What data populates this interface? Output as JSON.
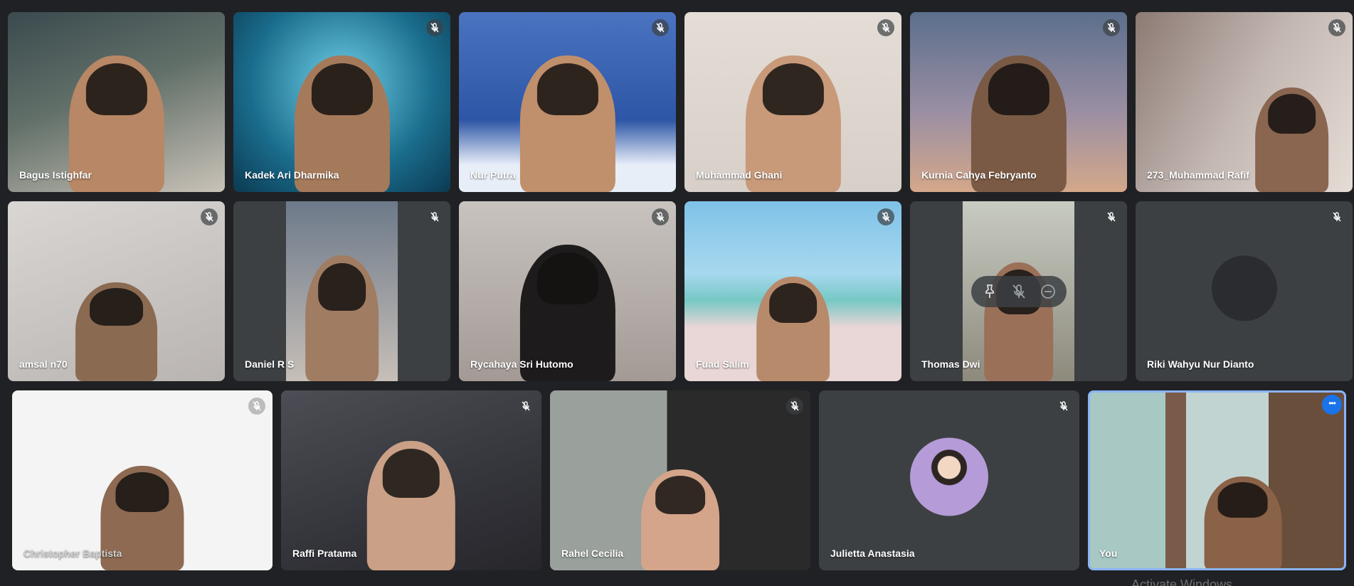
{
  "participants": [
    {
      "name": "Bagus Istighfar",
      "muted": false
    },
    {
      "name": "Kadek Ari Dharmika",
      "muted": true
    },
    {
      "name": "Nur Putra",
      "muted": true
    },
    {
      "name": "Muhammad Ghani",
      "muted": true
    },
    {
      "name": "Kurnia Cahya Febryanto",
      "muted": true
    },
    {
      "name": "273_Muhammad Rafif",
      "muted": true
    },
    {
      "name": "amsal n70",
      "muted": true
    },
    {
      "name": "Daniel R S",
      "muted": true
    },
    {
      "name": "Rycahaya Sri Hutomo",
      "muted": true
    },
    {
      "name": "Fuad Salim",
      "muted": true
    },
    {
      "name": "Thomas Dwi",
      "muted": true
    },
    {
      "name": "Riki Wahyu Nur Dianto",
      "muted": true
    },
    {
      "name": "Christopher Baptista",
      "muted": true
    },
    {
      "name": "Raffi Pratama",
      "muted": true
    },
    {
      "name": "Rahel Cecilia",
      "muted": true
    },
    {
      "name": "Julietta Anastasia",
      "muted": true
    },
    {
      "name": "You",
      "muted": false
    }
  ],
  "hover_controls": [
    "pin-icon",
    "mute-icon",
    "remove-icon"
  ],
  "icons": {
    "mute": "mic-off-icon",
    "more": "more-options-icon"
  },
  "colors": {
    "background": "#202124",
    "tile": "#3c4043",
    "self_border": "#8ab4f8",
    "more_button": "#1a73e8"
  },
  "watermark": "Activate Windows"
}
